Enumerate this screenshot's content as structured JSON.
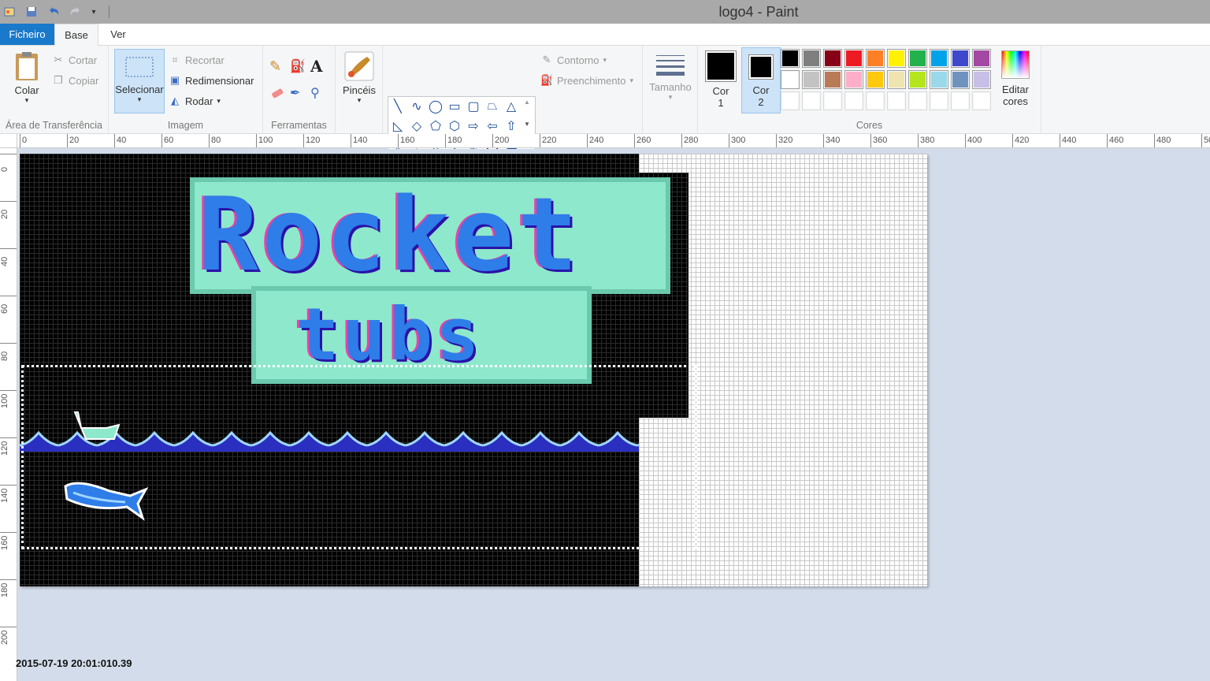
{
  "window": {
    "title": "logo4 - Paint"
  },
  "quick_access": {
    "icons": [
      "paint-app-icon",
      "save-icon",
      "undo-icon",
      "redo-icon",
      "customize-dropdown-icon"
    ]
  },
  "tabs": {
    "file": "Ficheiro",
    "base": "Base",
    "view": "Ver"
  },
  "ribbon": {
    "clipboard": {
      "paste": "Colar",
      "cut": "Cortar",
      "copy": "Copiar",
      "label": "Área de Transferência"
    },
    "image": {
      "select": "Selecionar",
      "crop": "Recortar",
      "resize": "Redimensionar",
      "rotate": "Rodar",
      "label": "Imagem"
    },
    "tools": {
      "label": "Ferramentas"
    },
    "brushes": {
      "label": "Pincéis"
    },
    "shapes": {
      "outline": "Contorno",
      "fill": "Preenchimento",
      "label": "Formas"
    },
    "size": {
      "label": "Tamanho"
    },
    "colors": {
      "color1_a": "Cor",
      "color1_b": "1",
      "color2_a": "Cor",
      "color2_b": "2",
      "edit_a": "Editar",
      "edit_b": "cores",
      "label": "Cores",
      "color1_value": "#000000",
      "color2_value": "#000000",
      "palette_row1": [
        "#000000",
        "#7f7f7f",
        "#880015",
        "#ed1c24",
        "#ff7f27",
        "#fff200",
        "#22b14c",
        "#00a2e8",
        "#3f48cc",
        "#a349a4"
      ],
      "palette_row2": [
        "#ffffff",
        "#c3c3c3",
        "#b97a57",
        "#ffaec9",
        "#ffc90e",
        "#efe4b0",
        "#b5e61d",
        "#99d9ea",
        "#7092be",
        "#c8bfe7"
      ],
      "palette_row3": [
        "#ffffff",
        "#ffffff",
        "#ffffff",
        "#ffffff",
        "#ffffff",
        "#ffffff",
        "#ffffff",
        "#ffffff",
        "#ffffff",
        "#ffffff"
      ]
    }
  },
  "rulers": {
    "horizontal": [
      "0",
      "20",
      "40",
      "60",
      "80",
      "100",
      "120",
      "140",
      "160",
      "180",
      "200",
      "220",
      "240",
      "260",
      "280",
      "300",
      "320",
      "340",
      "360",
      "380",
      "400",
      "420",
      "440",
      "460",
      "480",
      "50"
    ],
    "vertical": [
      "0",
      "20",
      "40",
      "60",
      "80",
      "100",
      "120",
      "140",
      "160",
      "180",
      "200"
    ]
  },
  "canvas": {
    "logo_line1": "Rocket",
    "logo_line2": "tubs"
  },
  "overlay": {
    "timestamp": "2015-07-19 20:01:010.39"
  }
}
